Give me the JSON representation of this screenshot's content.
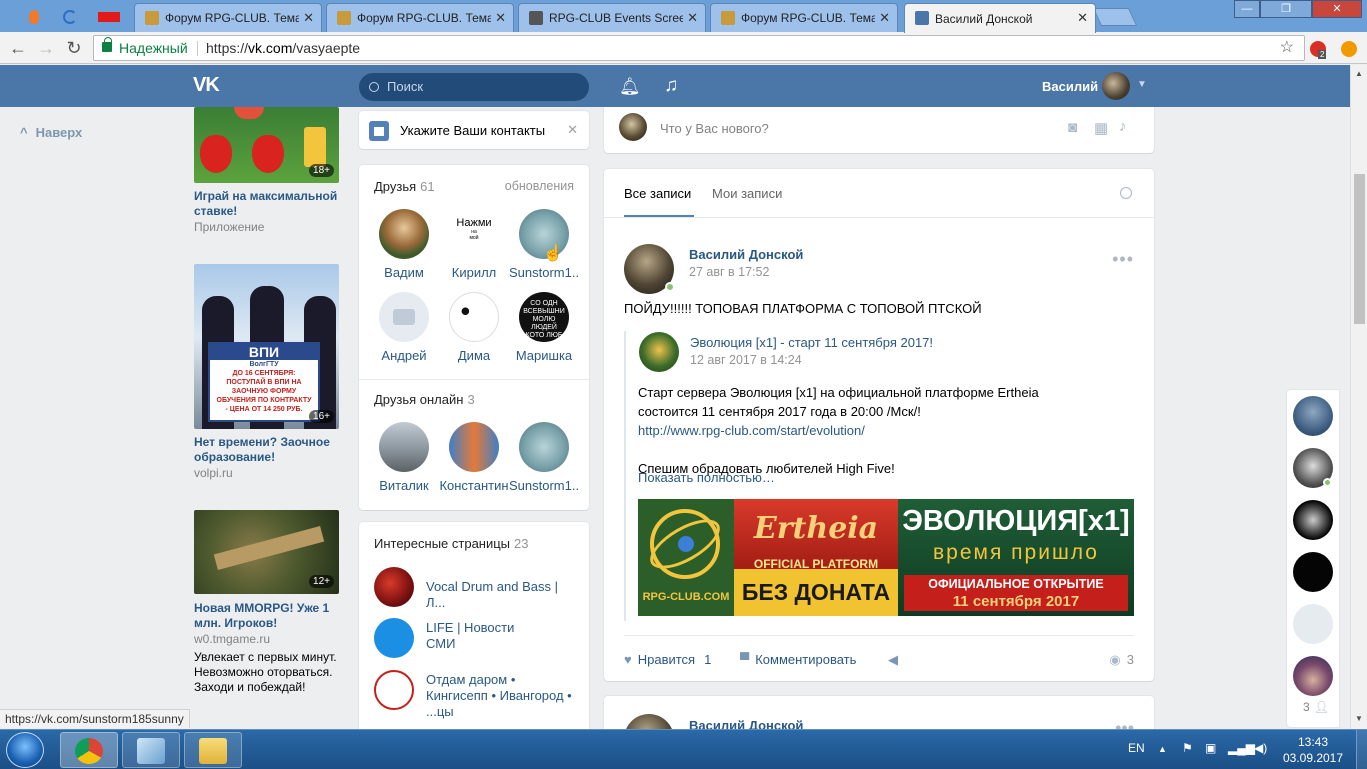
{
  "browser": {
    "tabs": [
      {
        "label": "Форум RPG-CLUB. Тема",
        "close": "✕"
      },
      {
        "label": "Форум RPG-CLUB. Тема",
        "close": "✕"
      },
      {
        "label": "RPG-CLUB Events Screen",
        "close": "✕"
      },
      {
        "label": "Форум RPG-CLUB. Тема",
        "close": "✕"
      },
      {
        "label": "Василий Донской",
        "close": "✕"
      }
    ],
    "secure_label": "Надежный",
    "url_scheme": "https://",
    "url_host": "vk.com",
    "url_path": "/vasyaepte",
    "ext_badge": "2",
    "window_controls": {
      "minimize": "—",
      "maximize": "❐",
      "close": "✕"
    }
  },
  "vk_header": {
    "logo": "VK",
    "search_placeholder": "Поиск",
    "user_name": "Василий"
  },
  "sidebar": {
    "back_top": "Наверх"
  },
  "ads": [
    {
      "title": "Играй на максимальной ставке!",
      "sub": "Приложение",
      "age": "18+"
    },
    {
      "title": "Нет времени? Заочное образование!",
      "sub": "volpi.ru",
      "age": "16+",
      "image_text": {
        "brand": "ВПИ",
        "city": "ВолгГТУ",
        "line1": "ДО 16 СЕНТЯБРЯ:",
        "line2": "ПОСТУПАЙ В ВПИ НА",
        "line3": "ЗАОЧНУЮ ФОРМУ",
        "line4": "ОБУЧЕНИЯ ПО КОНТРАКТУ",
        "line5": "- ЦЕНА ОТ 14 250 РУБ."
      }
    },
    {
      "title": "Новая MMORPG! Уже 1 млн. Игроков!",
      "sub": "w0.tmgame.ru",
      "age": "12+",
      "desc": "Увлекает с первых минут. Невозможно оторваться. Заходи и побеждай!"
    }
  ],
  "contacts_card": {
    "label": "Укажите Ваши контакты",
    "close": "✕"
  },
  "friends": {
    "title": "Друзья",
    "count": "61",
    "updates": "обновления",
    "items": [
      {
        "name": "Вадим"
      },
      {
        "name": "Кирилл",
        "avatar_text": "Нажми",
        "avatar_sub": "на",
        "avatar_sub2": "мой"
      },
      {
        "name": "Sunstorm1..."
      },
      {
        "name": "Андрей"
      },
      {
        "name": "Дима"
      },
      {
        "name": "Маришка",
        "avatar_text": "СО ОДН ВСЕВЫШНИ МОЛЮ ЛЮДЕЙ КОТО ЛЮБ"
      }
    ]
  },
  "friends_online": {
    "title": "Друзья онлайн",
    "count": "3",
    "items": [
      {
        "name": "Виталик"
      },
      {
        "name": "Константин"
      },
      {
        "name": "Sunstorm1..."
      }
    ]
  },
  "pages": {
    "title": "Интересные страницы",
    "count": "23",
    "items": [
      {
        "name": "Vocal Drum and Bass | Л..."
      },
      {
        "name": "LIFE | Новости",
        "name2": "СМИ"
      },
      {
        "name": "Отдам даром •",
        "name2": "Кингисепп • Ивангород •",
        "name3": "...цы"
      }
    ]
  },
  "composer": {
    "placeholder": "Что у Вас нового?"
  },
  "feed_tabs": {
    "all": "Все записи",
    "mine": "Мои записи"
  },
  "post": {
    "author": "Василий Донской",
    "date": "27 авг в 17:52",
    "text": "ПОЙДУ!!!!!! ТОПОВАЯ ПЛАТФОРМА С ТОПОВОЙ ПТСКОЙ",
    "repost": {
      "title": "Эволюция [x1] - старт 11 сентября 2017!",
      "date": "12 авг 2017 в 14:24",
      "line1": "Старт сервера Эволюция [x1] на официальной платформе Ertheia",
      "line2": "состоится 11 сентября 2017 года в 20:00 /Мск/!",
      "link": "http://www.rpg-club.com/start/evolution/",
      "line4": "Спешим обрадовать любителей High Five!",
      "show_full": "Показать полностью…",
      "banner": {
        "site": "RPG-CLUB.COM",
        "ertheia": "Ertheia",
        "official": "OFFICIAL PLATFORM",
        "no_donate": "БЕЗ ДОНАТА",
        "evolution": "ЭВОЛЮЦИЯ[x1]",
        "time": "время пришло",
        "opening": "ОФИЦИАЛЬНОЕ ОТКРЫТИЕ",
        "opening_date": "11 сентября 2017"
      }
    },
    "like_label": "Нравится",
    "like_count": "1",
    "comment_label": "Комментировать",
    "views": "3"
  },
  "next_post": {
    "author": "Василий Донской"
  },
  "online_strip": {
    "count": "3"
  },
  "status_url": "https://vk.com/sunstorm185sunny",
  "taskbar": {
    "lang": "EN",
    "time": "13:43",
    "date": "03.09.2017"
  },
  "colors": {
    "vk_blue": "#4a76a8",
    "link": "#2a5885",
    "bg": "#edeef0"
  },
  "icons": [
    "back-arrow-icon",
    "forward-arrow-icon",
    "reload-icon",
    "lock-icon",
    "star-icon",
    "bell-icon",
    "music-icon",
    "search-icon",
    "camera-icon",
    "video-icon",
    "audio-icon",
    "heart-icon",
    "comment-icon",
    "share-icon",
    "eye-icon"
  ]
}
